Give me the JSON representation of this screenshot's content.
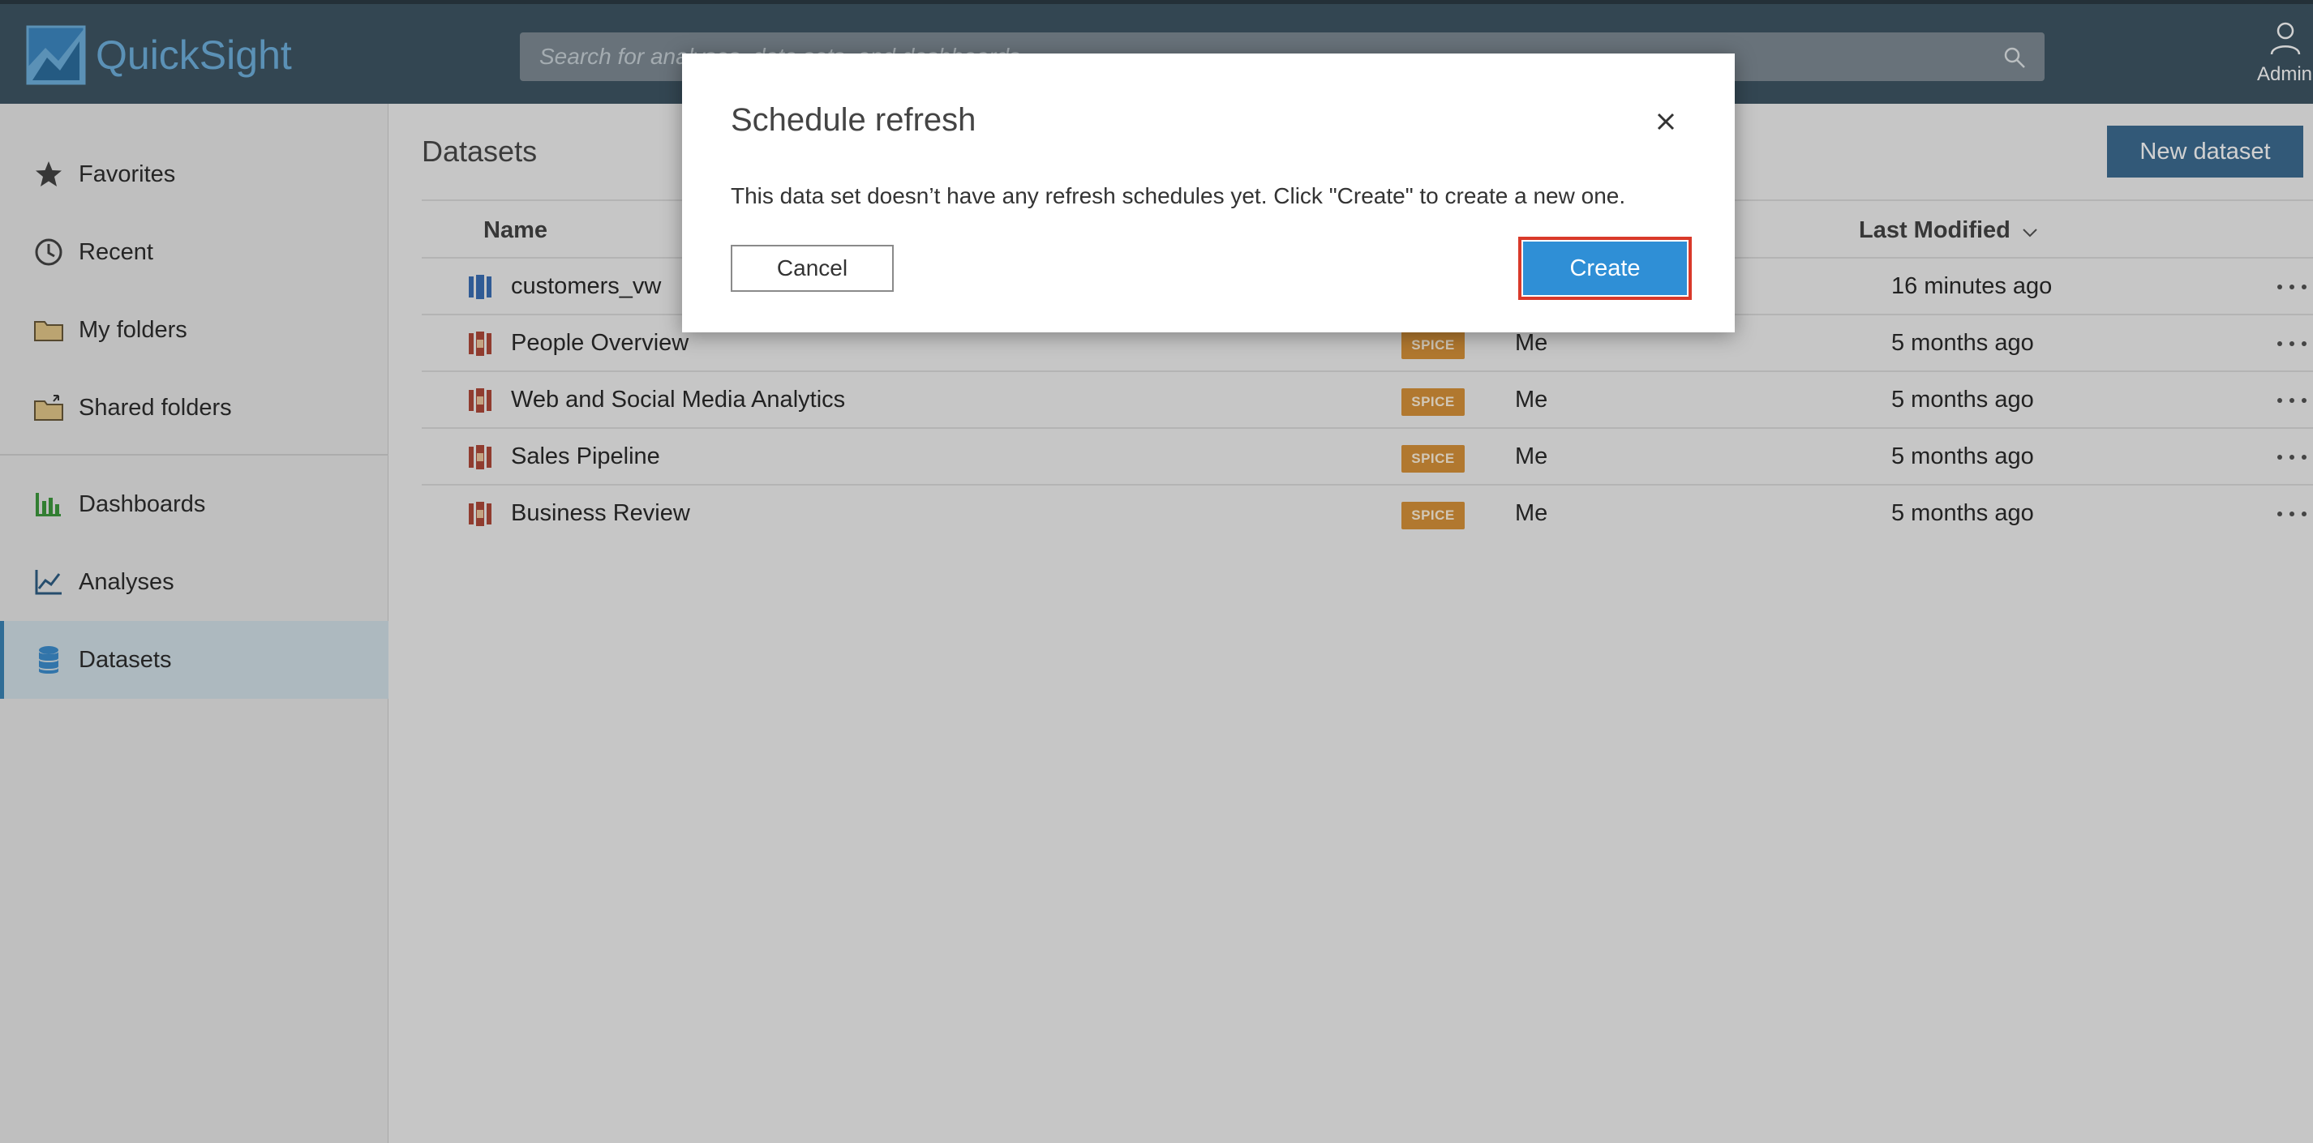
{
  "app": {
    "name": "QuickSight"
  },
  "search": {
    "placeholder": "Search for analyses, data sets, and dashboards"
  },
  "user": {
    "label": "Admin"
  },
  "sidebar": {
    "items": [
      {
        "label": "Favorites",
        "icon": "star-icon"
      },
      {
        "label": "Recent",
        "icon": "clock-icon"
      },
      {
        "label": "My folders",
        "icon": "folder-icon"
      },
      {
        "label": "Shared folders",
        "icon": "shared-folder-icon"
      },
      {
        "label": "Dashboards",
        "icon": "dashboard-icon"
      },
      {
        "label": "Analyses",
        "icon": "analyses-icon"
      },
      {
        "label": "Datasets",
        "icon": "datasets-icon",
        "active": true
      }
    ]
  },
  "main": {
    "title": "Datasets",
    "new_dataset_label": "New dataset",
    "columns": {
      "name": "Name",
      "last_modified": "Last Modified"
    },
    "rows": [
      {
        "name": "customers_vw",
        "badge": "",
        "owner": "",
        "modified": "16 minutes ago",
        "icon_color": "#3b6fb6"
      },
      {
        "name": "People Overview",
        "badge": "SPICE",
        "owner": "Me",
        "modified": "5 months ago",
        "icon_color": "#b04a3a"
      },
      {
        "name": "Web and Social Media Analytics",
        "badge": "SPICE",
        "owner": "Me",
        "modified": "5 months ago",
        "icon_color": "#b04a3a"
      },
      {
        "name": "Sales Pipeline",
        "badge": "SPICE",
        "owner": "Me",
        "modified": "5 months ago",
        "icon_color": "#b04a3a"
      },
      {
        "name": "Business Review",
        "badge": "SPICE",
        "owner": "Me",
        "modified": "5 months ago",
        "icon_color": "#b04a3a"
      }
    ]
  },
  "modal": {
    "title": "Schedule refresh",
    "message": "This data set doesn’t have any refresh schedules yet. Click \"Create\" to create a new one.",
    "cancel_label": "Cancel",
    "create_label": "Create"
  },
  "colors": {
    "topbar": "#3f5665",
    "accent": "#2f8fd6",
    "highlight": "#d9392a",
    "spice_badge": "#d8933a"
  }
}
